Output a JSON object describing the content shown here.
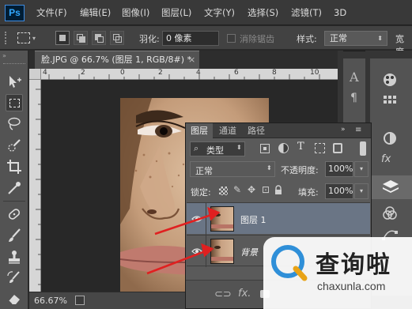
{
  "app": {
    "logo": "Ps"
  },
  "menu": [
    "文件(F)",
    "编辑(E)",
    "图像(I)",
    "图层(L)",
    "文字(Y)",
    "选择(S)",
    "滤镜(T)",
    "3D"
  ],
  "options": {
    "feather_label": "羽化:",
    "feather_value": "0 像素",
    "antialias_label": "消除锯齿",
    "style_label": "样式:",
    "style_value": "正常",
    "width_label": "宽度"
  },
  "document": {
    "tab_title": "脸.JPG @ 66.7% (图层 1, RGB/8#) *",
    "zoom": "66.67%",
    "ruler_ticks": [
      "4",
      "2",
      "0",
      "2",
      "4",
      "6",
      "8",
      "10"
    ]
  },
  "layers_panel": {
    "tabs": [
      "图层",
      "通道",
      "路径"
    ],
    "filter_type": "类型",
    "blend_mode": "正常",
    "opacity_label": "不透明度:",
    "opacity_value": "100%",
    "lock_label": "锁定:",
    "fill_label": "填充:",
    "fill_value": "100%",
    "layers": [
      {
        "name": "图层 1",
        "selected": true
      },
      {
        "name": "背景",
        "selected": false
      }
    ]
  },
  "watermark": {
    "title": "查询啦",
    "url": "chaxunla.com"
  },
  "colors": {
    "accent": "#31a8ff",
    "arrow": "#e02020",
    "selected_layer": "#6a7585"
  }
}
